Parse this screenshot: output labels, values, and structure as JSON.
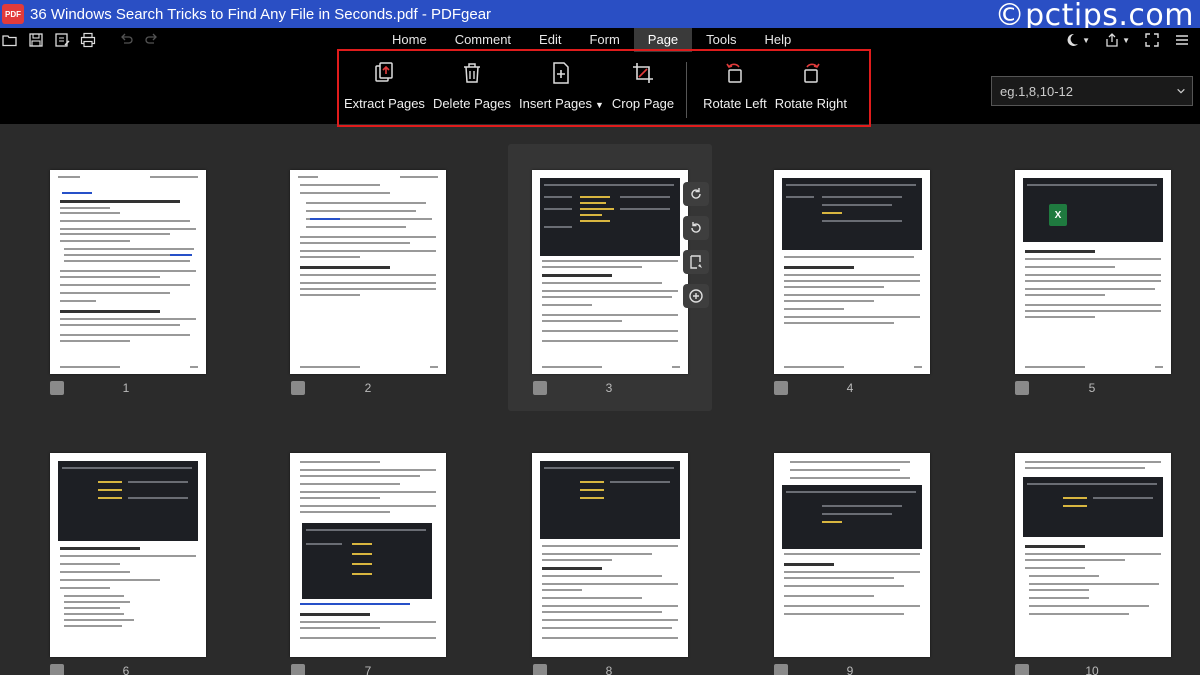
{
  "window": {
    "title": "36 Windows Search Tricks to Find Any File in Seconds.pdf - PDFgear",
    "logo_text": "PDF",
    "watermark": "©pctips.com"
  },
  "menu": {
    "tabs": [
      {
        "label": "Home",
        "active": false
      },
      {
        "label": "Comment",
        "active": false
      },
      {
        "label": "Edit",
        "active": false
      },
      {
        "label": "Form",
        "active": false
      },
      {
        "label": "Page",
        "active": true
      },
      {
        "label": "Tools",
        "active": false
      },
      {
        "label": "Help",
        "active": false
      }
    ]
  },
  "quick_tools": [
    "open-icon",
    "save-icon",
    "save-as-icon",
    "print-icon",
    "undo-icon",
    "redo-icon"
  ],
  "ribbon": {
    "extract": "Extract Pages",
    "delete": "Delete Pages",
    "insert": "Insert Pages",
    "crop": "Crop Page",
    "rotate_left": "Rotate Left",
    "rotate_right": "Rotate Right"
  },
  "page_range": {
    "placeholder": "eg.1,8,10-12"
  },
  "pages": [
    {
      "num": "1"
    },
    {
      "num": "2"
    },
    {
      "num": "3",
      "selected": true
    },
    {
      "num": "4"
    },
    {
      "num": "5"
    },
    {
      "num": "6"
    },
    {
      "num": "7"
    },
    {
      "num": "8"
    },
    {
      "num": "9"
    },
    {
      "num": "10"
    }
  ],
  "colors": {
    "titlebar": "#2a4fc4",
    "highlight": "#e01c1c",
    "rotate_accent": "#e23b3b",
    "background": "#2b2b2b"
  }
}
